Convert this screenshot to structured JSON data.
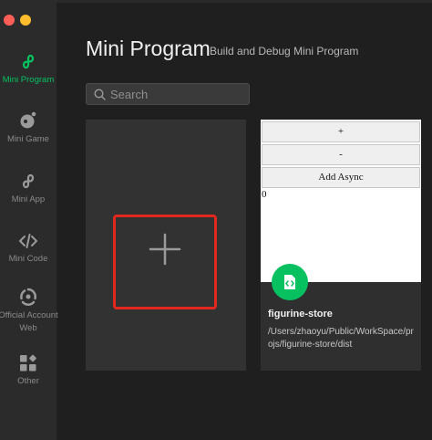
{
  "colors": {
    "accent": "#07c160",
    "highlight_box": "#e0281e",
    "sidebar_bg": "#2b2b2b",
    "main_bg": "#1f1f1f",
    "card_bg": "#323232"
  },
  "sidebar": {
    "items": [
      {
        "label": "Mini Program",
        "icon": "mini-program-icon",
        "active": true
      },
      {
        "label": "Mini Game",
        "icon": "mini-game-icon",
        "active": false
      },
      {
        "label": "Mini App",
        "icon": "mini-app-icon",
        "active": false
      },
      {
        "label": "Mini Code",
        "icon": "code-icon",
        "active": false
      },
      {
        "label": "Official Account",
        "label2": "Web",
        "icon": "official-account-icon",
        "active": false
      },
      {
        "label": "Other",
        "icon": "other-icon",
        "active": false
      }
    ]
  },
  "header": {
    "title": "Mini Program",
    "subtitle": "Build and Debug Mini Program"
  },
  "search": {
    "placeholder": "Search",
    "value": ""
  },
  "new_project_card": {
    "icon": "plus-icon"
  },
  "project_card": {
    "preview": {
      "buttons": [
        "+",
        "-",
        "Add Async"
      ],
      "counter": "0"
    },
    "icon": "js-file-icon",
    "name": "figurine-store",
    "path": "/Users/zhaoyu/Public/WorkSpace/projs/figurine-store/dist"
  }
}
